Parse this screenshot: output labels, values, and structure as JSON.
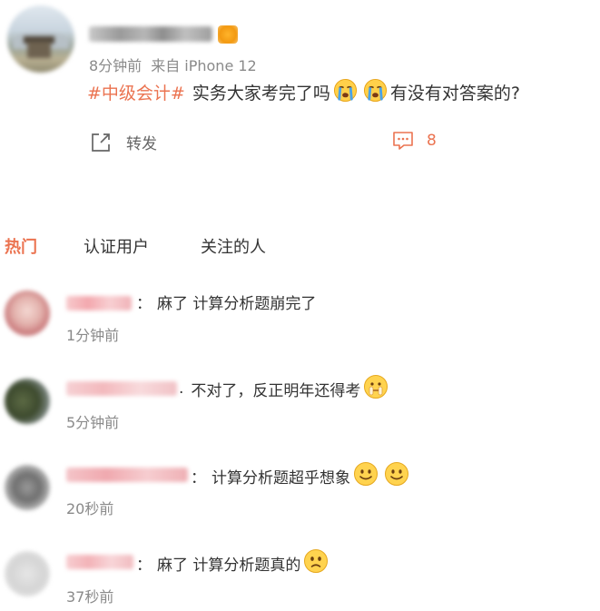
{
  "post": {
    "time": "8分钟前",
    "source": "来自 iPhone 12",
    "hashtag": "#中级会计#",
    "text_before": "实务大家考完了吗",
    "text_after": "有没有对答案的?",
    "emojis": [
      "crying-emoji",
      "crying-emoji"
    ],
    "repost_label": "转发",
    "comment_count": "8"
  },
  "tabs": [
    {
      "label": "热门",
      "active": true
    },
    {
      "label": "认证用户",
      "active": false
    },
    {
      "label": "关注的人",
      "active": false
    }
  ],
  "comments": [
    {
      "separator": "：",
      "text": "麻了 计算分析题崩完了",
      "time": "1分钟前",
      "emojis": []
    },
    {
      "separator": ".",
      "text": "不对了，反正明年还得考",
      "time": "5分钟前",
      "emojis": [
        "sealed-lips-emoji"
      ]
    },
    {
      "separator": "：",
      "text": "计算分析题超乎想象",
      "time": "20秒前",
      "emojis": [
        "smile-emoji",
        "smile-emoji"
      ]
    },
    {
      "separator": "：",
      "text": "麻了 计算分析题真的",
      "time": "37秒前",
      "emojis": [
        "sad-emoji"
      ]
    }
  ],
  "colors": {
    "accent": "#eb7350",
    "meta": "#8a8a8a",
    "text": "#333333"
  }
}
